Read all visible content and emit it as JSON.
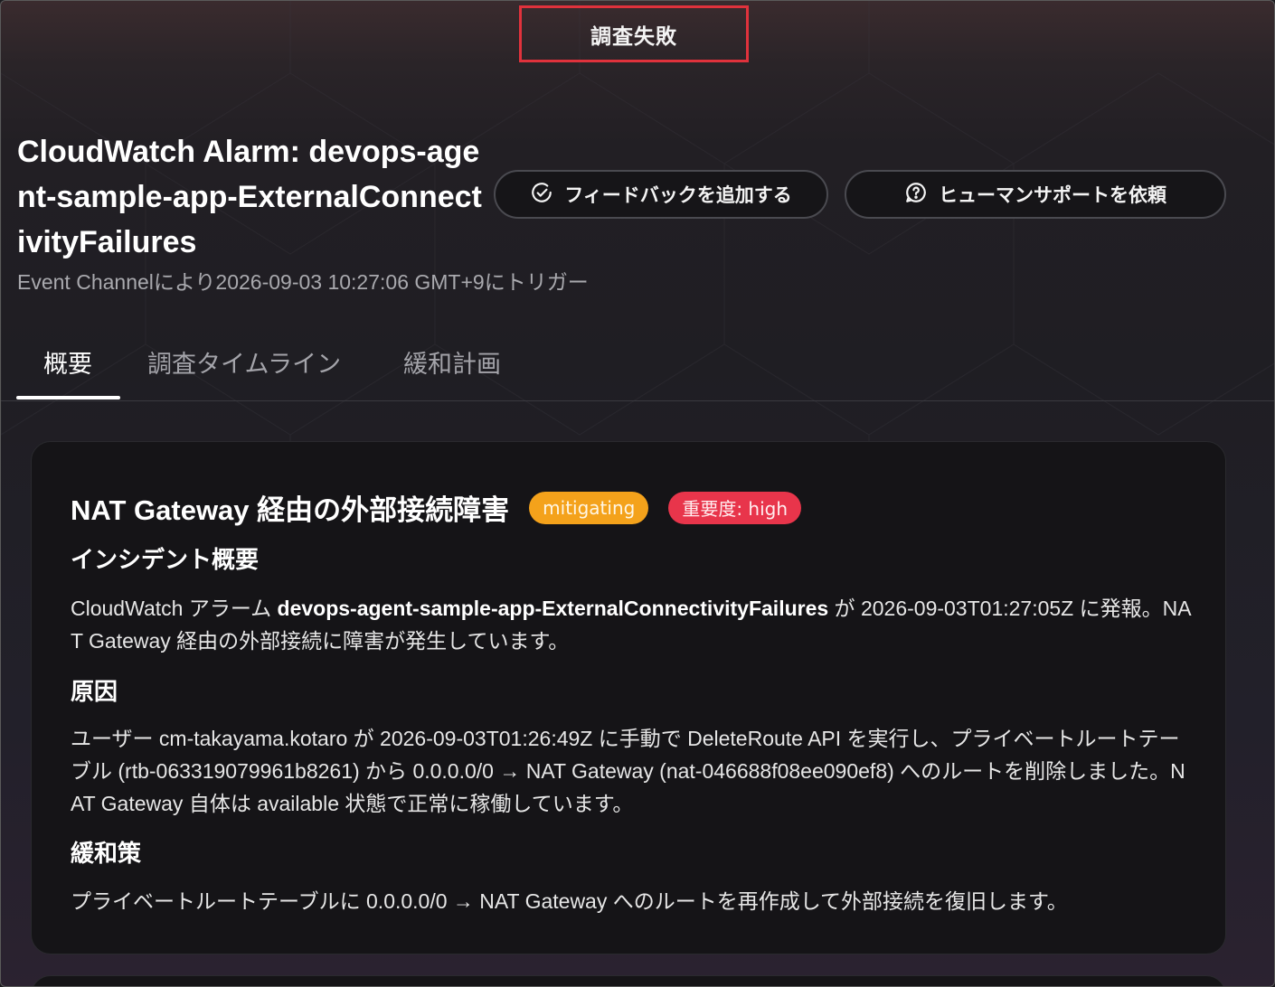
{
  "header": {
    "status_label": "調査失敗"
  },
  "investigation": {
    "title": "CloudWatch Alarm: devops-agent-sample-app-ExternalConnectivityFailures",
    "subtitle": "Event Channelにより2026-09-03 10:27:06 GMT+9にトリガー"
  },
  "actions": {
    "feedback_label": "フィードバックを追加する",
    "feedback_icon": "check-circle-icon",
    "support_label": "ヒューマンサポートを依頼",
    "support_icon": "question-chat-icon"
  },
  "tabs": [
    {
      "label": "概要",
      "active": true
    },
    {
      "label": "調査タイムライン",
      "active": false
    },
    {
      "label": "緩和計画",
      "active": false
    }
  ],
  "incident": {
    "title": "NAT Gateway 経由の外部接続障害",
    "status_badge": "mitigating",
    "severity_badge": "重要度: high",
    "colors": {
      "status": "#f4a21b",
      "severity": "#e8354b",
      "alert_border": "#e0323c"
    },
    "summary": {
      "heading": "インシデント概要",
      "text_before": "CloudWatch アラーム ",
      "alarm_name": "devops-agent-sample-app-ExternalConnectivityFailures",
      "text_after": " が 2026-09-03T01:27:05Z に発報。NAT Gateway 経由の外部接続に障害が発生しています。"
    },
    "cause": {
      "heading": "原因",
      "text": "ユーザー cm-takayama.kotaro が 2026-09-03T01:26:49Z に手動で DeleteRoute API を実行し、プライベートルートテーブル (rtb-063319079961b8261) から 0.0.0.0/0 → NAT Gateway (nat-046688f08ee090ef8) へのルートを削除しました。NAT Gateway 自体は available 状態で正常に稼働しています。"
    },
    "mitigation": {
      "heading": "緩和策",
      "text": "プライベートルートテーブルに 0.0.0.0/0 → NAT Gateway へのルートを再作成して外部接続を復旧します。"
    }
  }
}
